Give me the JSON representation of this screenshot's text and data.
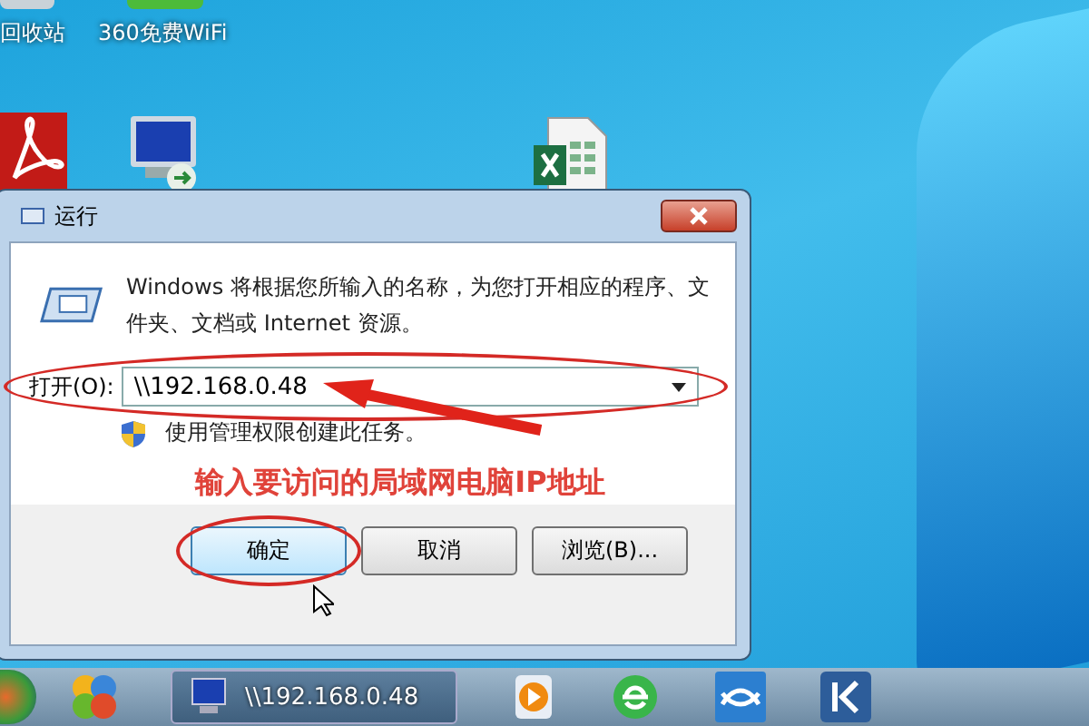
{
  "desktop_icons": [
    {
      "label": "回收站"
    },
    {
      "label": "360免费WiFi"
    }
  ],
  "dialog": {
    "title": "运行",
    "description": "Windows 将根据您所输入的名称，为您打开相应的程序、文件夹、文档或 Internet 资源。",
    "open_label": "打开(O):",
    "open_value": "\\\\192.168.0.48",
    "admin_note": "使用管理权限创建此任务。",
    "buttons": [
      {
        "label": "确定",
        "default": true
      },
      {
        "label": "取消",
        "default": false
      },
      {
        "label": "浏览(B)...",
        "default": false
      }
    ]
  },
  "annotation": {
    "text": "输入要访问的局域网电脑IP地址"
  },
  "taskbar": {
    "task_label": "\\\\192.168.0.48"
  }
}
